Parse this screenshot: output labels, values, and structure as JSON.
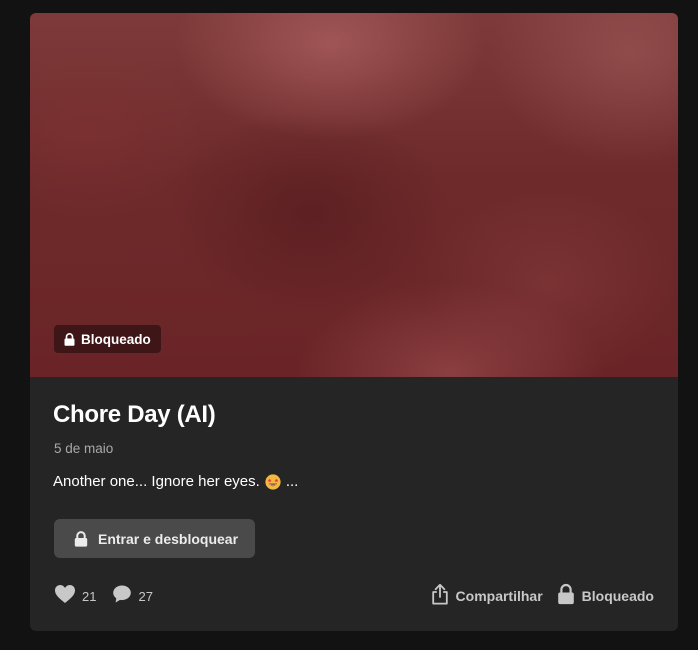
{
  "post": {
    "badge_label": "Bloqueado",
    "title": "Chore Day (AI)",
    "date": "5 de maio",
    "description": "Another one... Ignore her eyes.",
    "description_emoji": "star-struck-emoji",
    "description_ellipsis": "...",
    "unlock_button_label": "Entrar e desbloquear"
  },
  "stats": {
    "likes": "21",
    "comments": "27"
  },
  "actions": {
    "share_label": "Compartilhar",
    "locked_label": "Bloqueado"
  },
  "colors": {
    "page_background": "#121212",
    "card_background": "#252525",
    "badge_background": "#3f1617",
    "button_background": "#4a4a4a",
    "muted_text": "#a8a8a8"
  },
  "icons": [
    "lock-icon",
    "heart-icon",
    "comment-icon",
    "share-icon"
  ]
}
